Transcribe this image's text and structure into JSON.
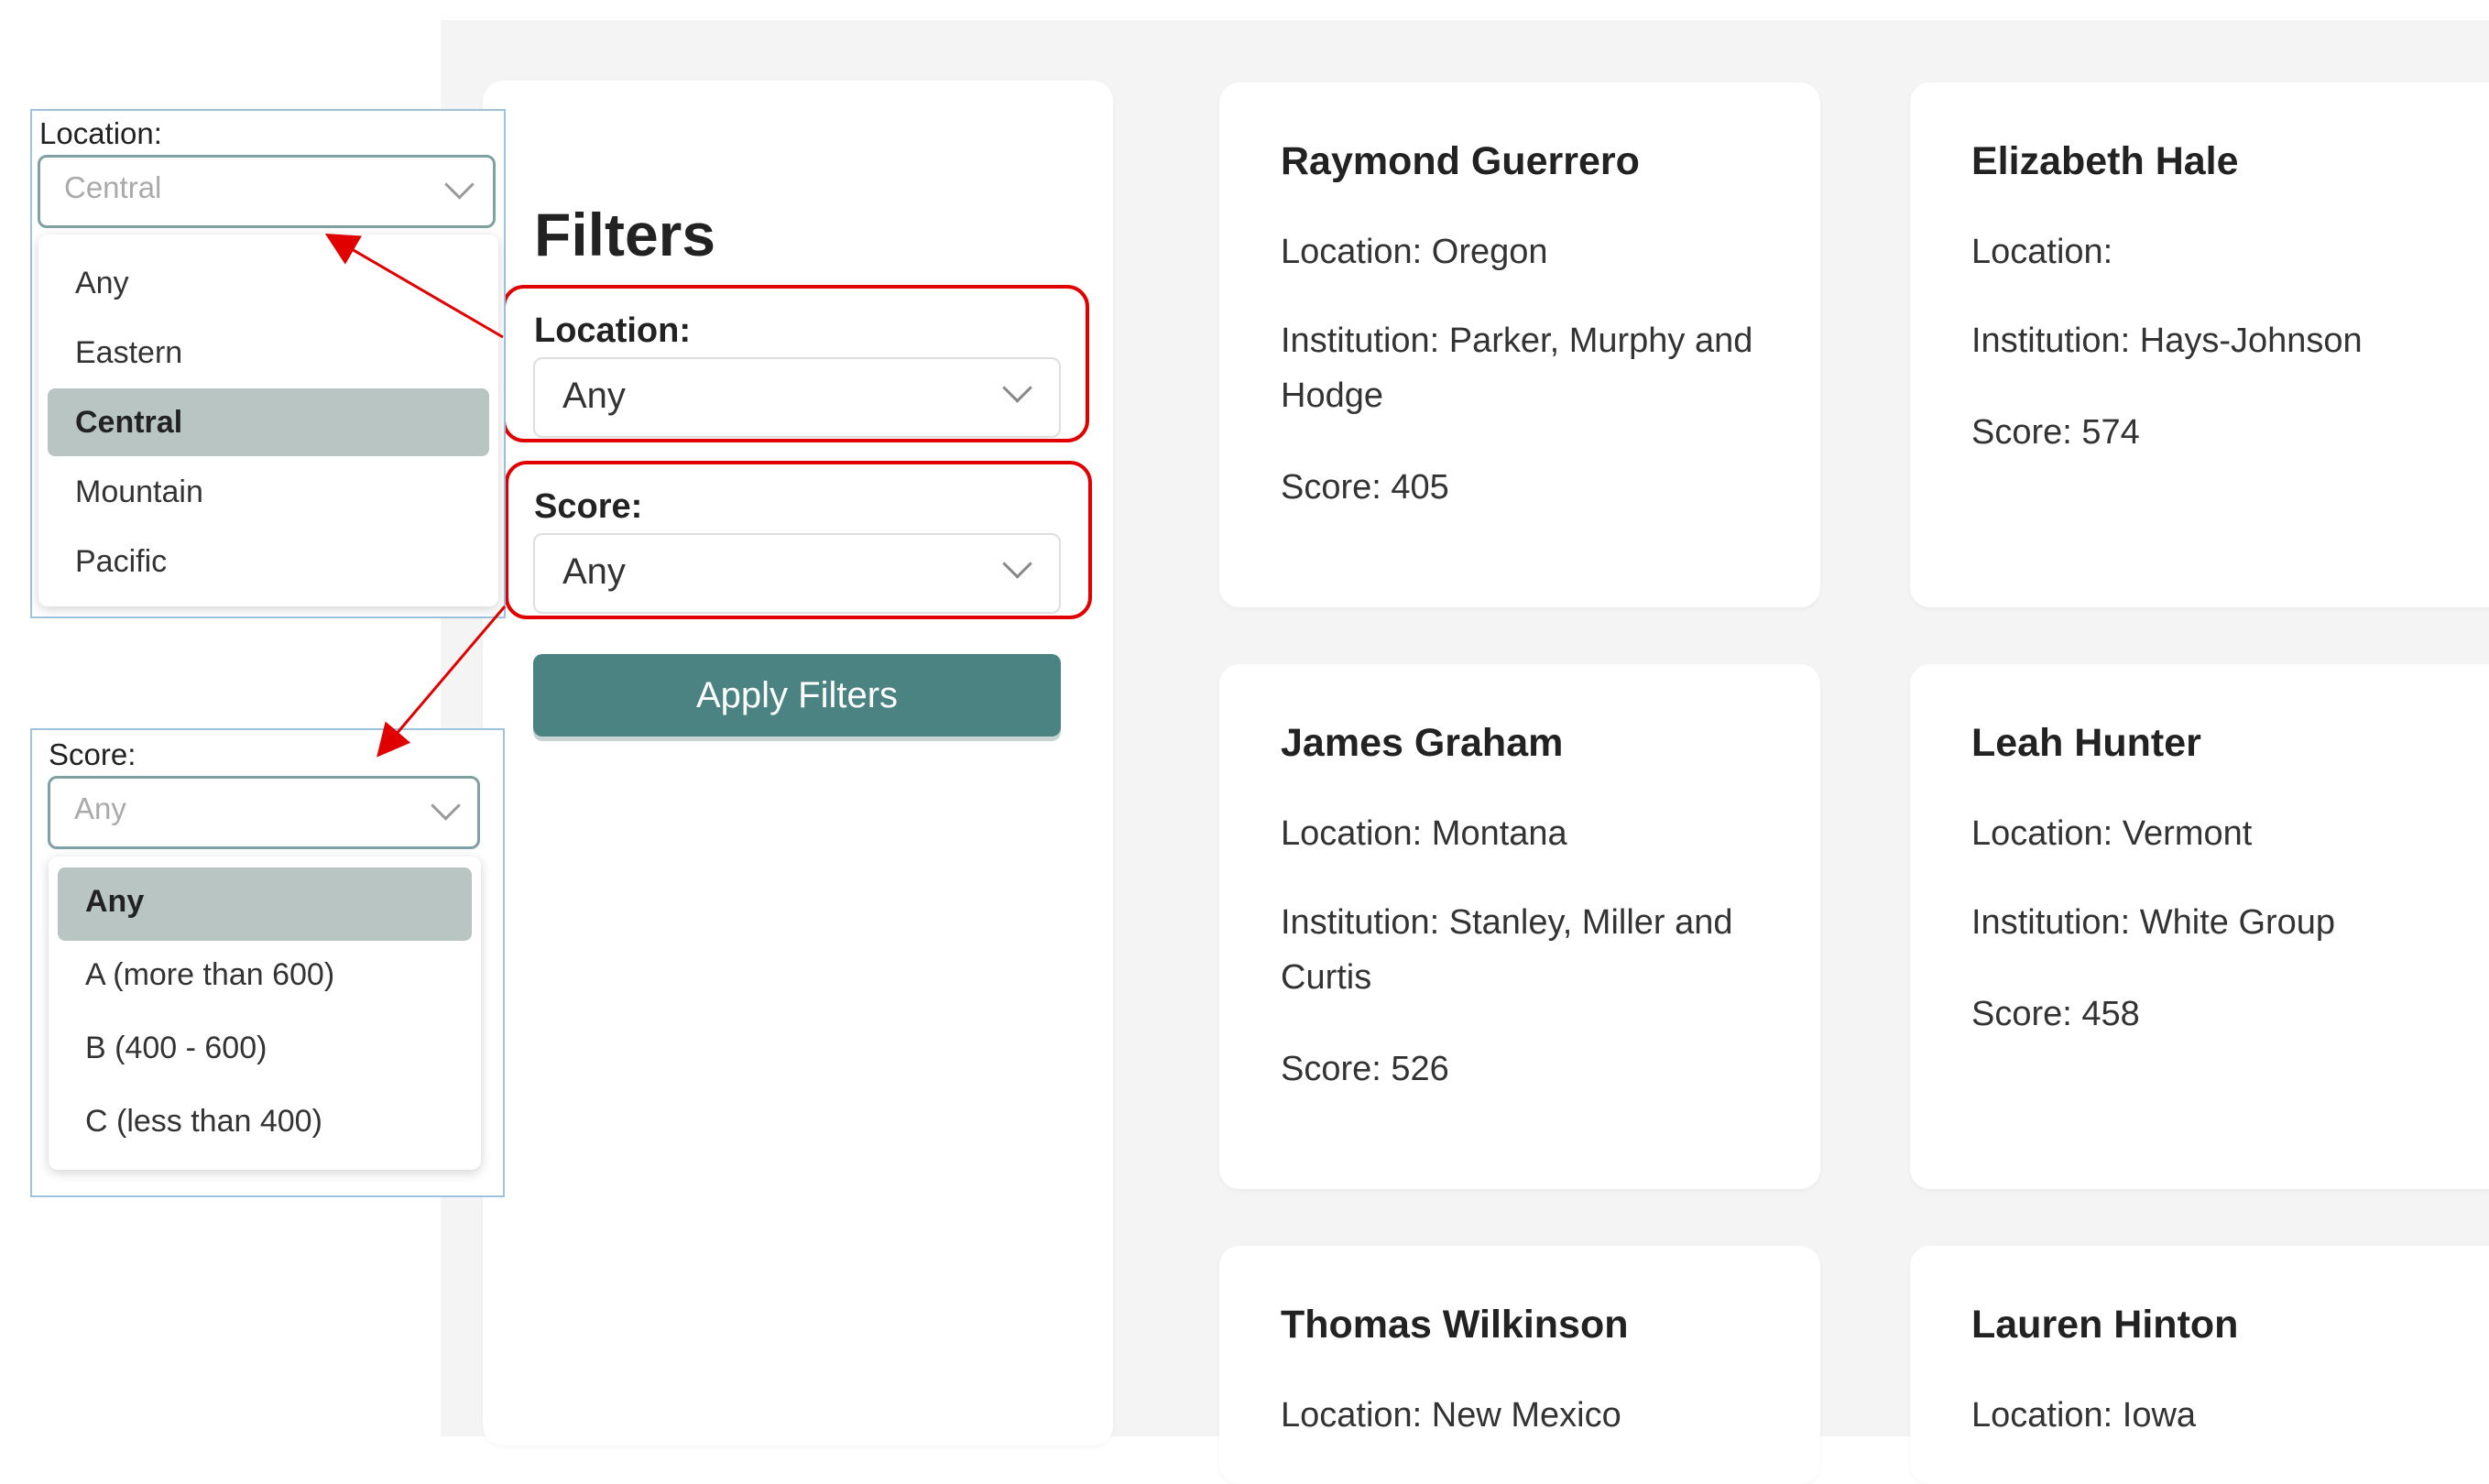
{
  "filters": {
    "title": "Filters",
    "location_label": "Location:",
    "location_value": "Any",
    "score_label": "Score:",
    "score_value": "Any",
    "apply_label": "Apply Filters"
  },
  "cards": [
    {
      "name": "Raymond Guerrero",
      "location": "Location: Oregon",
      "institution": [
        "Institution: Parker, Murphy and",
        "Hodge"
      ],
      "score": "Score: 405"
    },
    {
      "name": "Elizabeth Hale",
      "location": "Location:",
      "institution": [
        "Institution: Hays-Johnson"
      ],
      "score": "Score: 574"
    },
    {
      "name": "James Graham",
      "location": "Location: Montana",
      "institution": [
        "Institution: Stanley, Miller and",
        "Curtis"
      ],
      "score": "Score: 526"
    },
    {
      "name": "Leah Hunter",
      "location": "Location: Vermont",
      "institution": [
        "Institution: White Group"
      ],
      "score": "Score: 458"
    },
    {
      "name": "Thomas Wilkinson",
      "location": "Location: New Mexico"
    },
    {
      "name": "Lauren Hinton",
      "location": "Location: Iowa"
    }
  ],
  "location_popup": {
    "label": "Location:",
    "value": "Central",
    "options": [
      "Any",
      "Eastern",
      "Central",
      "Mountain",
      "Pacific"
    ],
    "selected": "Central"
  },
  "score_popup": {
    "label": "Score:",
    "value": "Any",
    "options": [
      "Any",
      "A (more than 600)",
      "B (400 - 600)",
      "C (less than 400)"
    ],
    "selected": "Any"
  },
  "colors": {
    "accent": "#4b8282",
    "highlight": "#e00000",
    "selected_option": "#b9c5c3",
    "background": "#f4f4f4"
  }
}
